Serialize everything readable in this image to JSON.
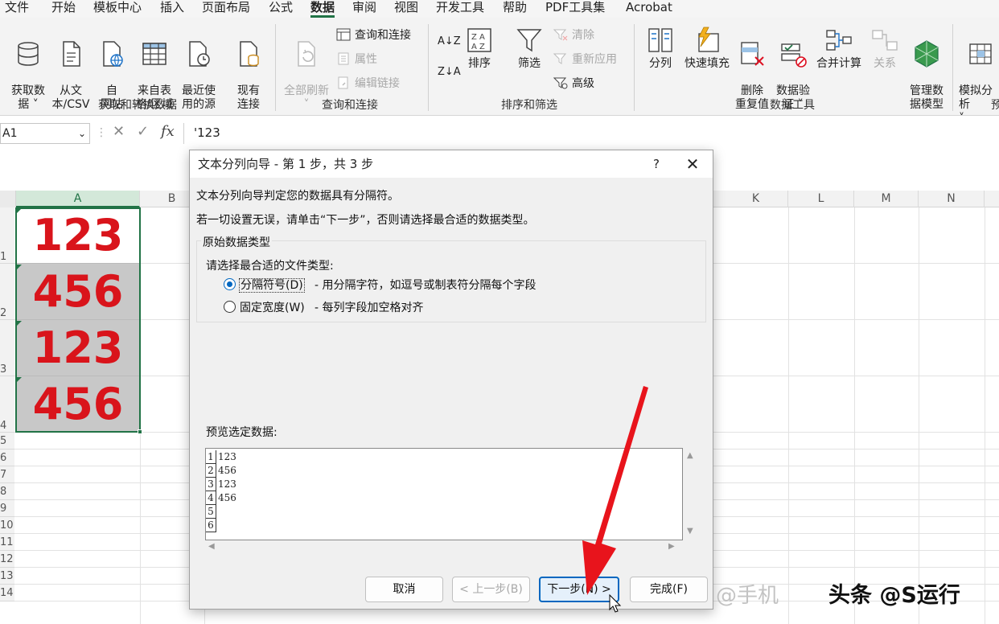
{
  "menu": {
    "tabs": [
      "文件",
      "开始",
      "模板中心",
      "插入",
      "页面布局",
      "公式",
      "数据",
      "审阅",
      "视图",
      "开发工具",
      "帮助",
      "PDF工具集",
      "Acrobat"
    ],
    "active_tab": "数据"
  },
  "ribbon": {
    "groups": {
      "get_transform": "获取和转换数据",
      "query_connect": "查询和连接",
      "sort_filter": "排序和筛选",
      "data_tools": "数据工具",
      "forecast_partial": "预"
    },
    "buttons": {
      "get_data": "获取数\n据 ˅",
      "from_csv": "从文\n本/CSV",
      "from_web": "自\n网站",
      "from_table": "来自表\n格/区域",
      "recent_sources": "最近使\n用的源",
      "existing_conn": "现有\n连接",
      "refresh_all": "全部刷新\n˅",
      "queries_conn": "查询和连接",
      "properties": "属性",
      "edit_links": "编辑链接",
      "sort_az": "A↓Z",
      "sort_za": "Z↓A",
      "sort": "排序",
      "filter": "筛选",
      "clear": "清除",
      "reapply": "重新应用",
      "advanced": "高级",
      "text_to_columns": "分列",
      "flash_fill": "快速填充",
      "remove_dupes": "删除\n重复值",
      "data_validation": "数据验\n证 ˅",
      "consolidate": "合并计算",
      "relationships": "关系",
      "data_model": "管理数\n据模型",
      "what_if": "模拟分析\n˅"
    }
  },
  "formula_bar": {
    "name_box": "A1",
    "cancel_symbol": "✕",
    "enter_symbol": "✓",
    "fx": "fx",
    "value": "'123"
  },
  "sheet": {
    "columns": [
      "A",
      "B",
      "K",
      "L",
      "M",
      "N"
    ],
    "row_numbers": [
      "1",
      "2",
      "3",
      "4",
      "5",
      "6",
      "7",
      "8",
      "9",
      "10",
      "11",
      "12",
      "13",
      "14"
    ],
    "cells_A": [
      "123",
      "456",
      "123",
      "456"
    ]
  },
  "dialog": {
    "title": "文本分列向导 - 第 1 步，共 3 步",
    "help": "?",
    "close": "✕",
    "intro_line1": "文本分列向导判定您的数据具有分隔符。",
    "intro_line2": "若一切设置无误，请单击“下一步”，否则请选择最合适的数据类型。",
    "group_title": "原始数据类型",
    "group_prompt": "请选择最合适的文件类型:",
    "option_delimited": "分隔符号(D)",
    "option_delimited_desc": "- 用分隔字符，如逗号或制表符分隔每个字段",
    "option_fixed": "固定宽度(W)",
    "option_fixed_desc": "- 每列字段加空格对齐",
    "preview_label": "预览选定数据:",
    "preview_rows": [
      {
        "num": "1",
        "value": "123"
      },
      {
        "num": "2",
        "value": "456"
      },
      {
        "num": "3",
        "value": "123"
      },
      {
        "num": "4",
        "value": "456"
      },
      {
        "num": "5",
        "value": ""
      },
      {
        "num": "6",
        "value": ""
      }
    ],
    "buttons": {
      "cancel": "取消",
      "back": "< 上一步(B)",
      "next": "下一步(N) >",
      "finish": "完成(F)"
    }
  },
  "watermark": {
    "main": "头条 @S运行",
    "faint": "@手机"
  },
  "colors": {
    "accent_green": "#217346",
    "cell_red": "#d9141b",
    "selection_gray": "#c8c8c8",
    "arrow_red": "#e8141c",
    "dialog_blue": "#0067c0"
  }
}
